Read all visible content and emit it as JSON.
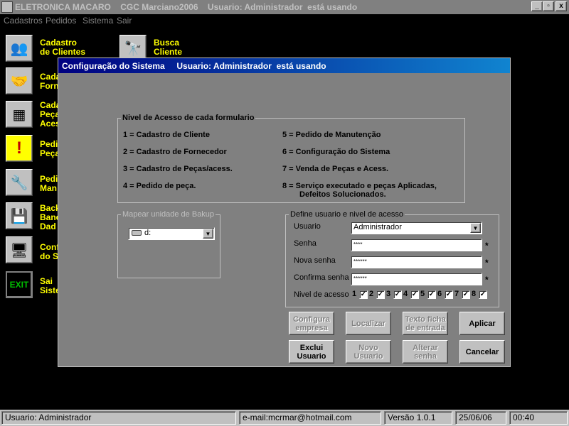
{
  "window": {
    "title": "ELETRONICA MACARO    CGC Marciano2006    Usuario: Administrador  está usando",
    "min_label": "_",
    "restore_label": "▫",
    "close_label": "x"
  },
  "menu": [
    "Cadastros",
    "Pedidos",
    "Sistema",
    "Sair"
  ],
  "shortcuts": [
    {
      "icon": "people-icon",
      "glyph": "👥",
      "label": "Cadastro\nde Clientes"
    },
    {
      "icon": "binoculars-icon",
      "glyph": "🔭",
      "label": "Busca\nCliente"
    },
    {
      "icon": "handshake-icon",
      "glyph": "🤝",
      "label": "Cada\nForn"
    },
    {
      "icon": "chip-icon",
      "glyph": "▦",
      "label": "Cada\nPeça\nAces"
    },
    {
      "icon": "alert-icon",
      "glyph": "!",
      "label": "Pedi\nPeça"
    },
    {
      "icon": "tools-icon",
      "glyph": "🔧",
      "label": "Pedi\nMan"
    },
    {
      "icon": "floppy-icon",
      "glyph": "💾",
      "label": "Back\nBanc\nDad"
    },
    {
      "icon": "monitor-icon",
      "glyph": "🖥",
      "label": "Conf\ndo S"
    },
    {
      "icon": "exit-icon",
      "glyph": "EXIT",
      "label": "Sai\nSiste"
    }
  ],
  "dialog": {
    "title": "Configuração do Sistema     Usuario: Administrador  está usando",
    "access_group": {
      "legend": "Nivel de Acesso de cada formulario",
      "left": [
        "1 = Cadastro de Cliente",
        "2 = Cadastro de Fornecedor",
        "3 = Cadastro de Peças/acess.",
        "4 = Pedido de peça."
      ],
      "right": [
        "5 = Pedido de Manutenção",
        "6 = Configuração do Sistema",
        "7 = Venda de Peças e Acess.",
        "8 = Serviço executado e peças Aplicadas,",
        "Defeitos Solucionados."
      ]
    },
    "backup_group": {
      "legend": "Mapear unidade de Bakup",
      "drive": "d:"
    },
    "user_group": {
      "legend": "Define usuario e nivel de acesso",
      "usuario_label": "Usuario",
      "usuario_value": "Administrador",
      "senha_label": "Senha",
      "senha_value": "****",
      "nova_label": "Nova senha",
      "nova_value": "******",
      "confirma_label": "Confirma senha",
      "confirma_value": "******",
      "nivel_label": "Nivel de acesso",
      "required_mark": "*",
      "levels": [
        "1",
        "2",
        "3",
        "4",
        "5",
        "6",
        "7",
        "8"
      ],
      "level_checked": [
        true,
        true,
        true,
        true,
        true,
        true,
        true,
        true
      ]
    },
    "buttons": {
      "configura": "Configura\nempresa",
      "localizar": "Localizar",
      "texto_ficha": "Texto ficha\nde entrada",
      "aplicar": "Aplicar",
      "exclui": "Exclui\nUsuario",
      "novo": "Novo\nUsuario",
      "alterar": "Alterar\nsenha",
      "cancelar": "Cancelar"
    }
  },
  "status": {
    "user": "Usuario: Administrador",
    "email": "e-mail:mcrmar@hotmail.com",
    "version": "Versão 1.0.1",
    "date": "25/06/06",
    "time": "00:40"
  }
}
